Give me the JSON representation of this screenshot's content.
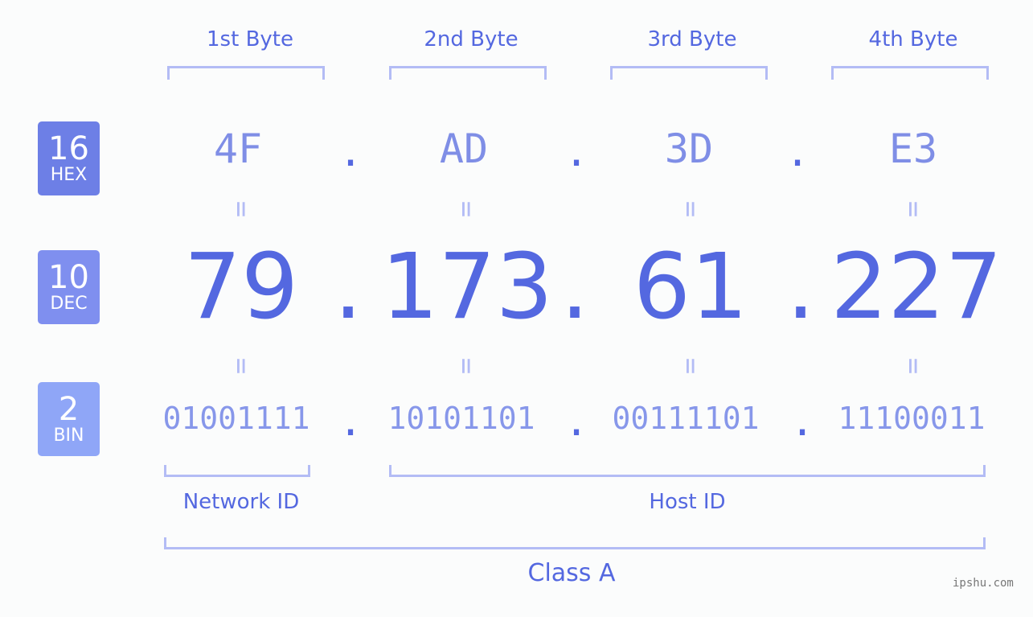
{
  "header": {
    "bytes": [
      "1st Byte",
      "2nd Byte",
      "3rd Byte",
      "4th Byte"
    ]
  },
  "badges": [
    {
      "number": "16",
      "label": "HEX",
      "color": "#6d7fe6"
    },
    {
      "number": "10",
      "label": "DEC",
      "color": "#7f8fef"
    },
    {
      "number": "2",
      "label": "BIN",
      "color": "#8fa6f7"
    }
  ],
  "hex": [
    "4F",
    "AD",
    "3D",
    "E3"
  ],
  "dec": [
    "79",
    "173",
    "61",
    "227"
  ],
  "bin": [
    "01001111",
    "10101101",
    "00111101",
    "11100011"
  ],
  "separator": ".",
  "equals": "=",
  "labels": {
    "network": "Network ID",
    "host": "Host ID",
    "class": "Class A"
  },
  "watermark": "ipshu.com"
}
